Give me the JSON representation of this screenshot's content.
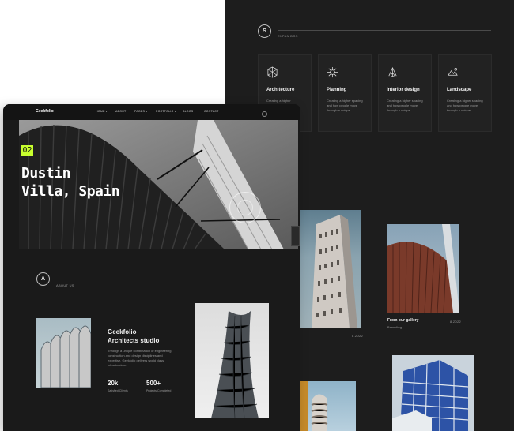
{
  "back": {
    "top_right_text": "·",
    "services": {
      "badge": "S",
      "label": "EXPAN DOS",
      "cards": [
        {
          "icon": "architecture-icon",
          "title": "Architecture",
          "desc": "Creating a higher"
        },
        {
          "icon": "planning-icon",
          "title": "Planning",
          "desc": "Creating a higher spacing and how people move through a unique."
        },
        {
          "icon": "interior-icon",
          "title": "Interior design",
          "desc": "Creating a higher spacing and how people move through a unique."
        },
        {
          "icon": "landscape-icon",
          "title": "Landscape",
          "desc": "Creating a higher spacing and how people move through a unique."
        }
      ]
    },
    "gallery": {
      "item1_date": "8.2022",
      "item2_title": "From our gallery",
      "item2_sub": "Branding",
      "item2_date": "8.2022"
    }
  },
  "front": {
    "nav": {
      "logo": "Geekfolio",
      "items": [
        "HOME ▾",
        "ABOUT",
        "PAGES ▾",
        "PORTFOLIO ▾",
        "BLOGS ▾",
        "CONTACT"
      ]
    },
    "hero": {
      "badge": "02",
      "title_line1": "Dustin",
      "title_line2": "Villa, Spain"
    },
    "about": {
      "badge": "A",
      "label": "ABOUT US",
      "heading_line1": "Geekfolio",
      "heading_line2": "Architects studio",
      "body": "Through a unique combination of engineering, construction and design disciplines and expertise, Geekfolio delivers world class infrastructure.",
      "stats": [
        {
          "value": "20k",
          "label": "Satisfied Clients"
        },
        {
          "value": "500+",
          "label": "Projects Completed"
        }
      ]
    }
  }
}
